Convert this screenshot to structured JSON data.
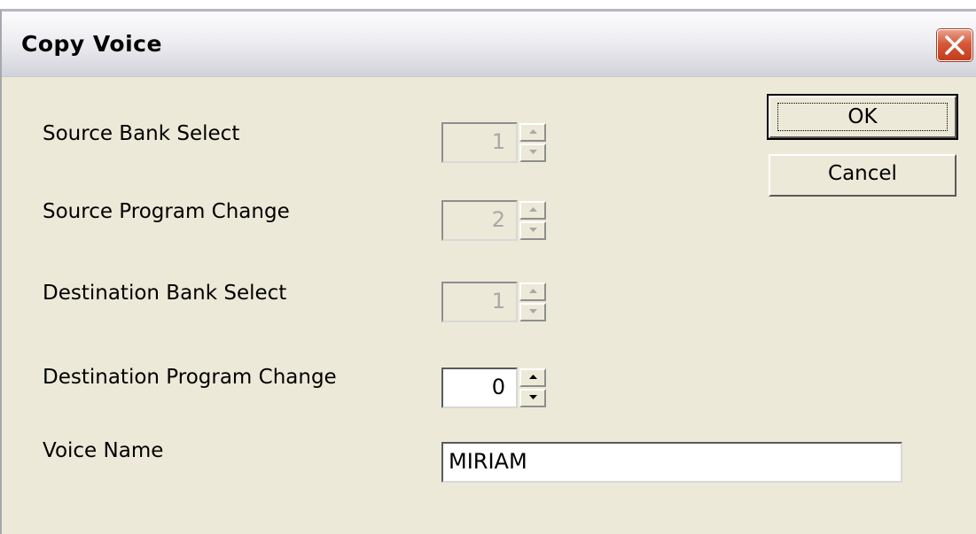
{
  "window": {
    "title": "Copy Voice"
  },
  "fields": {
    "source_bank_select": {
      "label": "Source Bank Select",
      "value": "1"
    },
    "source_program_change": {
      "label": "Source Program Change",
      "value": "2"
    },
    "destination_bank_select": {
      "label": "Destination Bank Select",
      "value": "1"
    },
    "destination_program_change": {
      "label": "Destination Program Change",
      "value": "0"
    },
    "voice_name": {
      "label": "Voice Name",
      "value": "MIRIAM"
    }
  },
  "buttons": {
    "ok_label": "OK",
    "cancel_label": "Cancel"
  },
  "icons": {
    "close": "close-icon",
    "spin_up": "arrow-up-icon",
    "spin_down": "arrow-down-icon"
  },
  "colors": {
    "dialog_background": "#ece9d8",
    "close_button": "#d6583a",
    "disabled_text": "#a8a8a8"
  }
}
